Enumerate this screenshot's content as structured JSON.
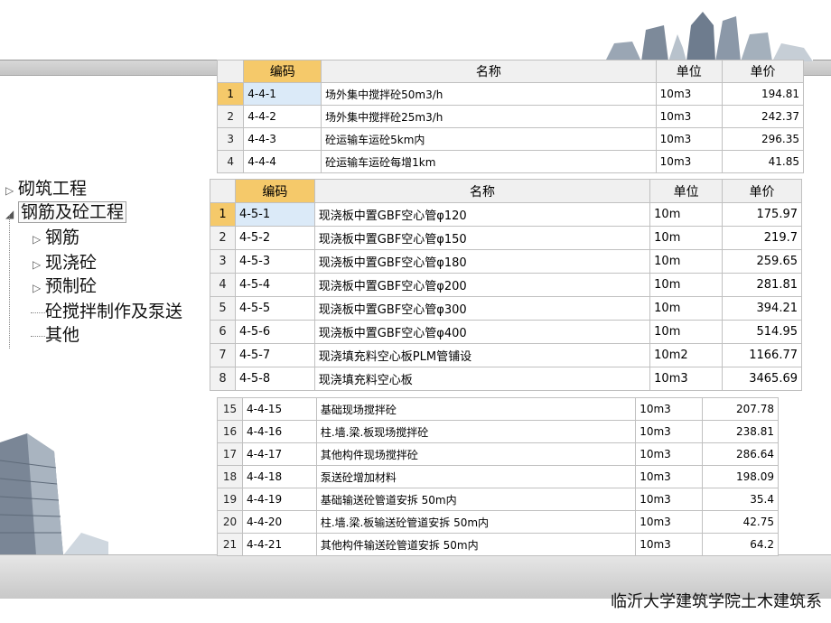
{
  "footer": "临沂大学建筑学院土木建筑系",
  "tree": {
    "items": [
      {
        "label": "砌筑工程",
        "expanded": false
      },
      {
        "label": "钢筋及砼工程",
        "expanded": true,
        "selected": true
      },
      {
        "label": "钢筋",
        "child": true
      },
      {
        "label": "现浇砼",
        "child": true
      },
      {
        "label": "预制砼",
        "child": true
      },
      {
        "label": "砼搅拌制作及泵送",
        "child": true,
        "leaf": true
      },
      {
        "label": "其他",
        "child": true,
        "leaf": true
      }
    ]
  },
  "table_top": {
    "headers": [
      "编码",
      "名称",
      "单位",
      "单价"
    ],
    "rows": [
      {
        "n": "1",
        "code": "4-4-1",
        "name": "场外集中搅拌砼50m3/h",
        "unit": "10m3",
        "price": "194.81"
      },
      {
        "n": "2",
        "code": "4-4-2",
        "name": "场外集中搅拌砼25m3/h",
        "unit": "10m3",
        "price": "242.37"
      },
      {
        "n": "3",
        "code": "4-4-3",
        "name": "砼运输车运砼5km内",
        "unit": "10m3",
        "price": "296.35"
      },
      {
        "n": "4",
        "code": "4-4-4",
        "name": "砼运输车运砼每增1km",
        "unit": "10m3",
        "price": "41.85"
      }
    ]
  },
  "table_mid": {
    "headers": [
      "编码",
      "名称",
      "单位",
      "单价"
    ],
    "rows": [
      {
        "n": "1",
        "code": "4-5-1",
        "name": "现浇板中置GBF空心管φ120",
        "unit": "10m",
        "price": "175.97"
      },
      {
        "n": "2",
        "code": "4-5-2",
        "name": "现浇板中置GBF空心管φ150",
        "unit": "10m",
        "price": "219.7"
      },
      {
        "n": "3",
        "code": "4-5-3",
        "name": "现浇板中置GBF空心管φ180",
        "unit": "10m",
        "price": "259.65"
      },
      {
        "n": "4",
        "code": "4-5-4",
        "name": "现浇板中置GBF空心管φ200",
        "unit": "10m",
        "price": "281.81"
      },
      {
        "n": "5",
        "code": "4-5-5",
        "name": "现浇板中置GBF空心管φ300",
        "unit": "10m",
        "price": "394.21"
      },
      {
        "n": "6",
        "code": "4-5-6",
        "name": "现浇板中置GBF空心管φ400",
        "unit": "10m",
        "price": "514.95"
      },
      {
        "n": "7",
        "code": "4-5-7",
        "name": "现浇填充料空心板PLM管铺设",
        "unit": "10m2",
        "price": "1166.77"
      },
      {
        "n": "8",
        "code": "4-5-8",
        "name": "现浇填充料空心板",
        "unit": "10m3",
        "price": "3465.69"
      }
    ]
  },
  "table_bottom": {
    "rows": [
      {
        "n": "15",
        "code": "4-4-15",
        "name": "基础现场搅拌砼",
        "unit": "10m3",
        "price": "207.78"
      },
      {
        "n": "16",
        "code": "4-4-16",
        "name": "柱.墙.梁.板现场搅拌砼",
        "unit": "10m3",
        "price": "238.81"
      },
      {
        "n": "17",
        "code": "4-4-17",
        "name": "其他构件现场搅拌砼",
        "unit": "10m3",
        "price": "286.64"
      },
      {
        "n": "18",
        "code": "4-4-18",
        "name": "泵送砼增加材料",
        "unit": "10m3",
        "price": "198.09"
      },
      {
        "n": "19",
        "code": "4-4-19",
        "name": "基础输送砼管道安拆 50m内",
        "unit": "10m3",
        "price": "35.4"
      },
      {
        "n": "20",
        "code": "4-4-20",
        "name": "柱.墙.梁.板输送砼管道安拆 50m内",
        "unit": "10m3",
        "price": "42.75"
      },
      {
        "n": "21",
        "code": "4-4-21",
        "name": "其他构件输送砼管道安拆 50m内",
        "unit": "10m3",
        "price": "64.2"
      }
    ]
  }
}
